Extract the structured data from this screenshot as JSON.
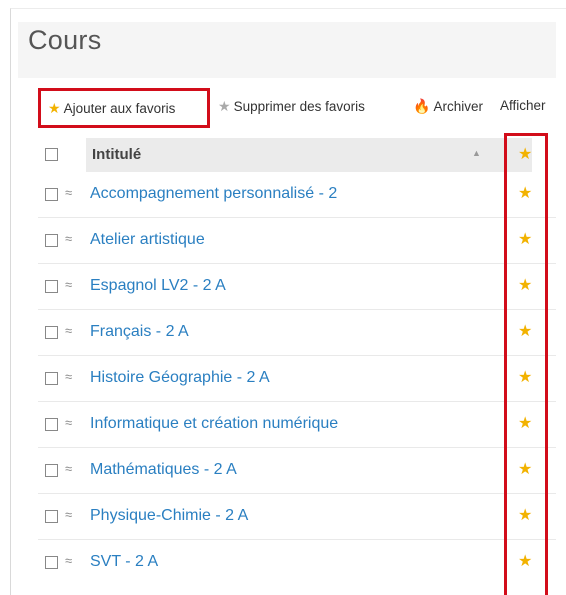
{
  "page": {
    "title": "Cours"
  },
  "toolbar": {
    "add_favorites": "Ajouter aux favoris",
    "remove_favorites": "Supprimer des favoris",
    "archive": "Archiver",
    "show": "Afficher"
  },
  "table": {
    "header": {
      "title": "Intitulé",
      "sort_glyph": "▲",
      "fav_glyph": "★"
    },
    "rows": [
      {
        "label": "Accompagnement personnalisé - 2",
        "favorite": true
      },
      {
        "label": "Atelier artistique",
        "favorite": true
      },
      {
        "label": "Espagnol LV2 - 2 A",
        "favorite": true
      },
      {
        "label": "Français - 2 A",
        "favorite": true
      },
      {
        "label": "Histoire Géographie - 2 A",
        "favorite": true
      },
      {
        "label": "Informatique et création numérique",
        "favorite": true
      },
      {
        "label": "Mathématiques - 2 A",
        "favorite": true
      },
      {
        "label": "Physique-Chimie - 2 A",
        "favorite": true
      },
      {
        "label": "SVT - 2 A",
        "favorite": true
      }
    ]
  },
  "icons": {
    "star": "★",
    "flame": "🔥",
    "cap": "≈"
  },
  "colors": {
    "accent_link": "#2a7fc1",
    "star": "#f2b200",
    "highlight": "#d20d1a"
  }
}
